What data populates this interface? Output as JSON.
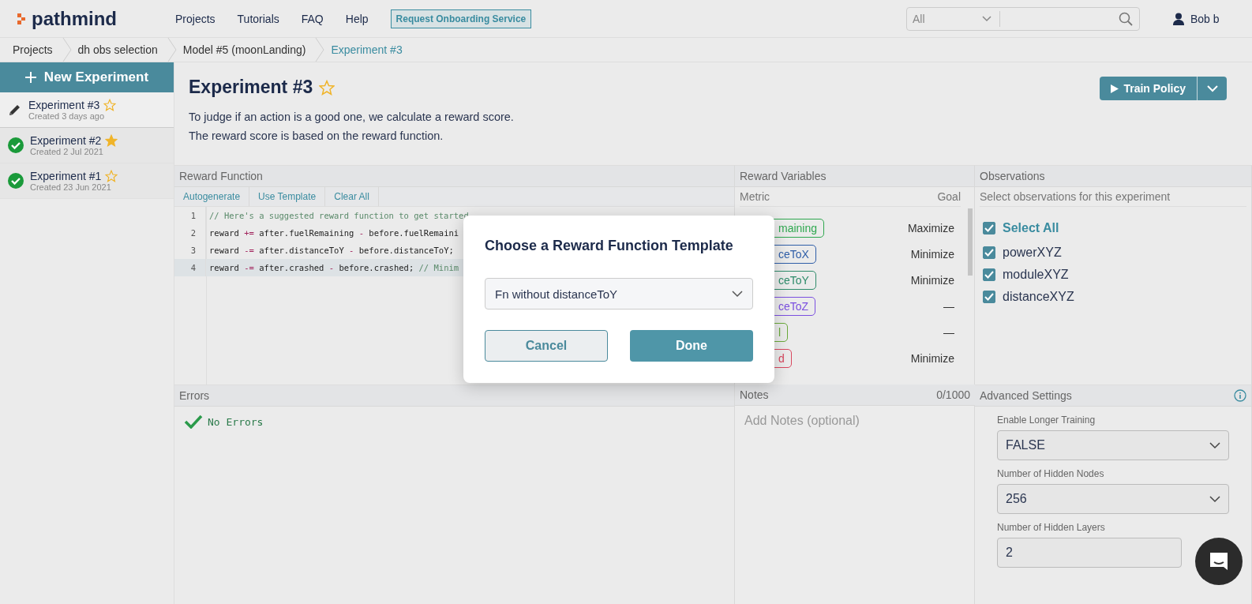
{
  "nav": {
    "logo": "pathmind",
    "links": [
      "Projects",
      "Tutorials",
      "FAQ",
      "Help"
    ],
    "cta": "Request Onboarding Service",
    "search_scope": "All",
    "user": "Bob b"
  },
  "breadcrumbs": [
    {
      "label": "Projects",
      "selected": false
    },
    {
      "label": "dh obs selection",
      "selected": false
    },
    {
      "label": "Model #5 (moonLanding)",
      "selected": false
    },
    {
      "label": "Experiment #3",
      "selected": true
    }
  ],
  "sidebar": {
    "new_button": "New Experiment",
    "items": [
      {
        "title": "Experiment #3",
        "subtitle": "Created 3 days ago",
        "kind": "draft",
        "favorite": false,
        "selected": true
      },
      {
        "title": "Experiment #2",
        "subtitle": "Created 2 Jul 2021",
        "kind": "completed",
        "favorite": true,
        "selected": false
      },
      {
        "title": "Experiment #1",
        "subtitle": "Created 23 Jun 2021",
        "kind": "completed",
        "favorite": false,
        "selected": false
      }
    ]
  },
  "experiment": {
    "title": "Experiment #3",
    "favorite": false,
    "description": [
      "To judge if an action is a good one, we calculate a reward score.",
      "The reward score is based on the reward function."
    ],
    "train_button": "Train Policy"
  },
  "reward_function": {
    "title": "Reward Function",
    "actions": [
      "Autogenerate",
      "Use Template",
      "Clear All"
    ],
    "lines": [
      {
        "number": "1",
        "selected": false,
        "tokens": [
          {
            "kind": "comment",
            "text": "// Here's a suggested reward function to get started"
          }
        ]
      },
      {
        "number": "2",
        "selected": false,
        "tokens": [
          {
            "kind": "plain",
            "text": "reward "
          },
          {
            "kind": "op",
            "text": "+="
          },
          {
            "kind": "plain",
            "text": " after.fuelRemaining "
          },
          {
            "kind": "op",
            "text": "-"
          },
          {
            "kind": "plain",
            "text": " before.fuelRemaini"
          }
        ]
      },
      {
        "number": "3",
        "selected": false,
        "tokens": [
          {
            "kind": "plain",
            "text": "reward "
          },
          {
            "kind": "op",
            "text": "-="
          },
          {
            "kind": "plain",
            "text": " after.distanceToY "
          },
          {
            "kind": "op",
            "text": "-"
          },
          {
            "kind": "plain",
            "text": " before.distanceToY;"
          }
        ]
      },
      {
        "number": "4",
        "selected": true,
        "tokens": [
          {
            "kind": "plain",
            "text": "reward "
          },
          {
            "kind": "op",
            "text": "-="
          },
          {
            "kind": "plain",
            "text": " after.crashed "
          },
          {
            "kind": "op",
            "text": "-"
          },
          {
            "kind": "plain",
            "text": " before.crashed; "
          },
          {
            "kind": "comment",
            "text": "// Minim"
          }
        ]
      }
    ]
  },
  "reward_variables": {
    "title": "Reward Variables",
    "metric_heading": "Metric",
    "goal_heading": "Goal",
    "rows": [
      {
        "metric": "maining",
        "color": "#2fa84f",
        "goal": "Maximize"
      },
      {
        "metric": "ceToX",
        "color": "#2f5ea8",
        "goal": "Minimize"
      },
      {
        "metric": "ceToY",
        "color": "#2e8b6a",
        "goal": "Minimize"
      },
      {
        "metric": "ceToZ",
        "color": "#7b4fe0",
        "goal": "—"
      },
      {
        "metric": "l",
        "color": "#6aaa3a",
        "goal": "—"
      },
      {
        "metric": "d",
        "color": "#d9485f",
        "goal": "Minimize"
      }
    ]
  },
  "observations": {
    "title": "Observations",
    "hint": "Select observations for this experiment",
    "select_all": {
      "label": "Select All",
      "checked": true
    },
    "items": [
      {
        "label": "powerXYZ",
        "checked": true
      },
      {
        "label": "moduleXYZ",
        "checked": true
      },
      {
        "label": "distanceXYZ",
        "checked": true
      }
    ]
  },
  "errors": {
    "title": "Errors",
    "message": "No Errors"
  },
  "notes": {
    "title": "Notes",
    "count": "0/1000",
    "placeholder": "Add Notes (optional)"
  },
  "advanced_settings": {
    "title": "Advanced Settings",
    "fields": [
      {
        "label": "Enable Longer Training",
        "value": "FALSE",
        "kind": "select"
      },
      {
        "label": "Number of Hidden Nodes",
        "value": "256",
        "kind": "select"
      },
      {
        "label": "Number of Hidden Layers",
        "value": "2",
        "kind": "input"
      }
    ]
  },
  "dialog": {
    "title": "Choose a Reward Function Template",
    "value": "Fn without distanceToY",
    "buttons": [
      "Cancel",
      "Done"
    ]
  }
}
